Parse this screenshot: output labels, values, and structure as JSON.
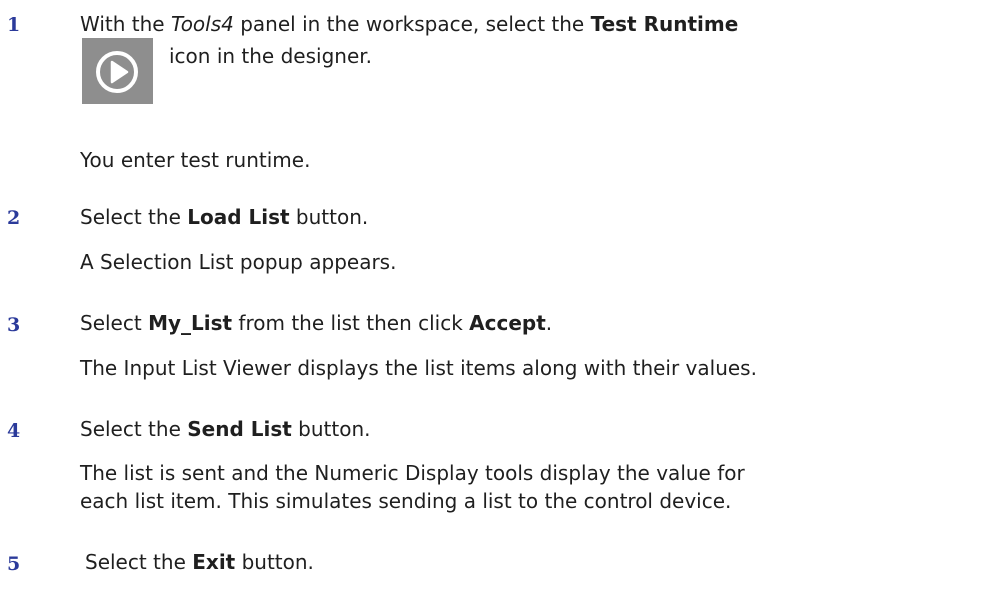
{
  "steps": [
    {
      "number": "1",
      "line1": {
        "t1": "With the ",
        "t2": "Tools4",
        "t3": " panel in the workspace, select the ",
        "t4": "Test Runtime"
      },
      "line2": "icon in the designer.",
      "icon": "play-circle-icon",
      "result": "You enter test runtime."
    },
    {
      "number": "2",
      "instruction": {
        "t1": "Select the ",
        "t2": "Load List",
        "t3": " button."
      },
      "result": "A Selection List popup appears."
    },
    {
      "number": "3",
      "instruction": {
        "t1": "Select ",
        "t2": "My_List",
        "t3": " from the list then click ",
        "t4": "Accept",
        "t5": "."
      },
      "result": "The Input List Viewer displays the list items along with their values."
    },
    {
      "number": "4",
      "instruction": {
        "t1": "Select the ",
        "t2": "Send List",
        "t3": " button."
      },
      "result_line1": "The list is sent and the Numeric Display tools display the value for",
      "result_line2": "each list item. This simulates sending a list to the control device."
    },
    {
      "number": "5",
      "instruction": {
        "t1": "Select the ",
        "t2": "Exit",
        "t3": " button."
      }
    }
  ],
  "colors": {
    "step_number": "#2b3a9a",
    "text": "#1f1f1f",
    "icon_background": "#8e8e8e",
    "icon_glyph": "#ffffff"
  }
}
